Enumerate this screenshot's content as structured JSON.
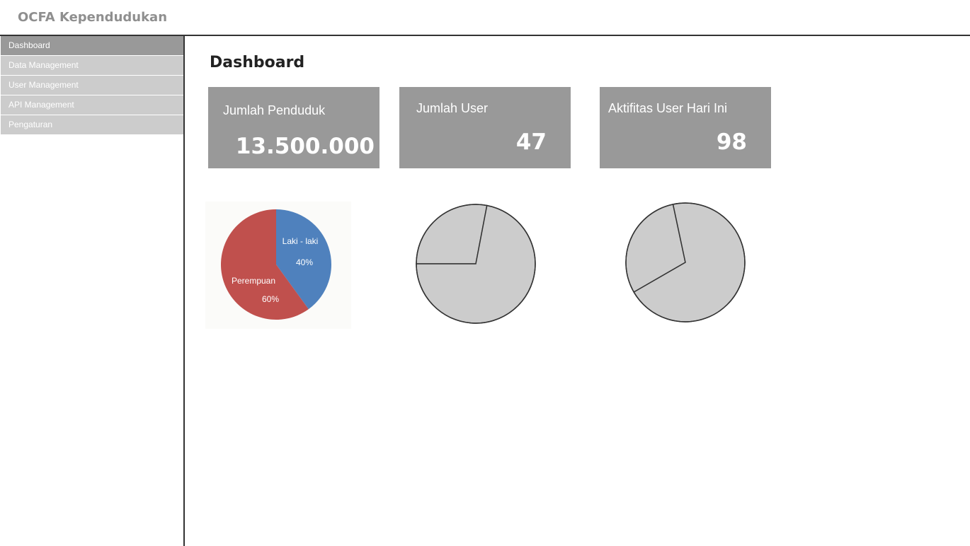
{
  "app": {
    "title": "OCFA Kependudukan"
  },
  "sidebar": {
    "items": [
      {
        "label": "Dashboard",
        "active": true
      },
      {
        "label": "Data Management",
        "active": false
      },
      {
        "label": "User Management",
        "active": false
      },
      {
        "label": "API Management",
        "active": false
      },
      {
        "label": "Pengaturan",
        "active": false
      }
    ]
  },
  "page": {
    "title": "Dashboard"
  },
  "cards": [
    {
      "label": "Jumlah Penduduk",
      "value": "13.500.000"
    },
    {
      "label": "Jumlah User",
      "value": "47"
    },
    {
      "label": "Aktifitas User Hari Ini",
      "value": "98"
    }
  ],
  "colors": {
    "card_bg": "#999999",
    "nav_bg": "#cccccc",
    "nav_active_bg": "#999999",
    "male": "#4f81bd",
    "female": "#c0504d",
    "placeholder_pie": "#cccccc"
  },
  "chart_data": [
    {
      "type": "pie",
      "title": "",
      "categories": [
        "Laki - laki",
        "Perempuan"
      ],
      "values": [
        40,
        60
      ],
      "value_labels": [
        "40%",
        "60%"
      ],
      "colors": [
        "#4f81bd",
        "#c0504d"
      ]
    },
    {
      "type": "pie",
      "title": "",
      "categories": [],
      "values": [
        28,
        72
      ],
      "colors": [
        "#cccccc",
        "#cccccc"
      ]
    },
    {
      "type": "pie",
      "title": "",
      "categories": [],
      "values": [
        30,
        70
      ],
      "colors": [
        "#cccccc",
        "#cccccc"
      ]
    }
  ]
}
